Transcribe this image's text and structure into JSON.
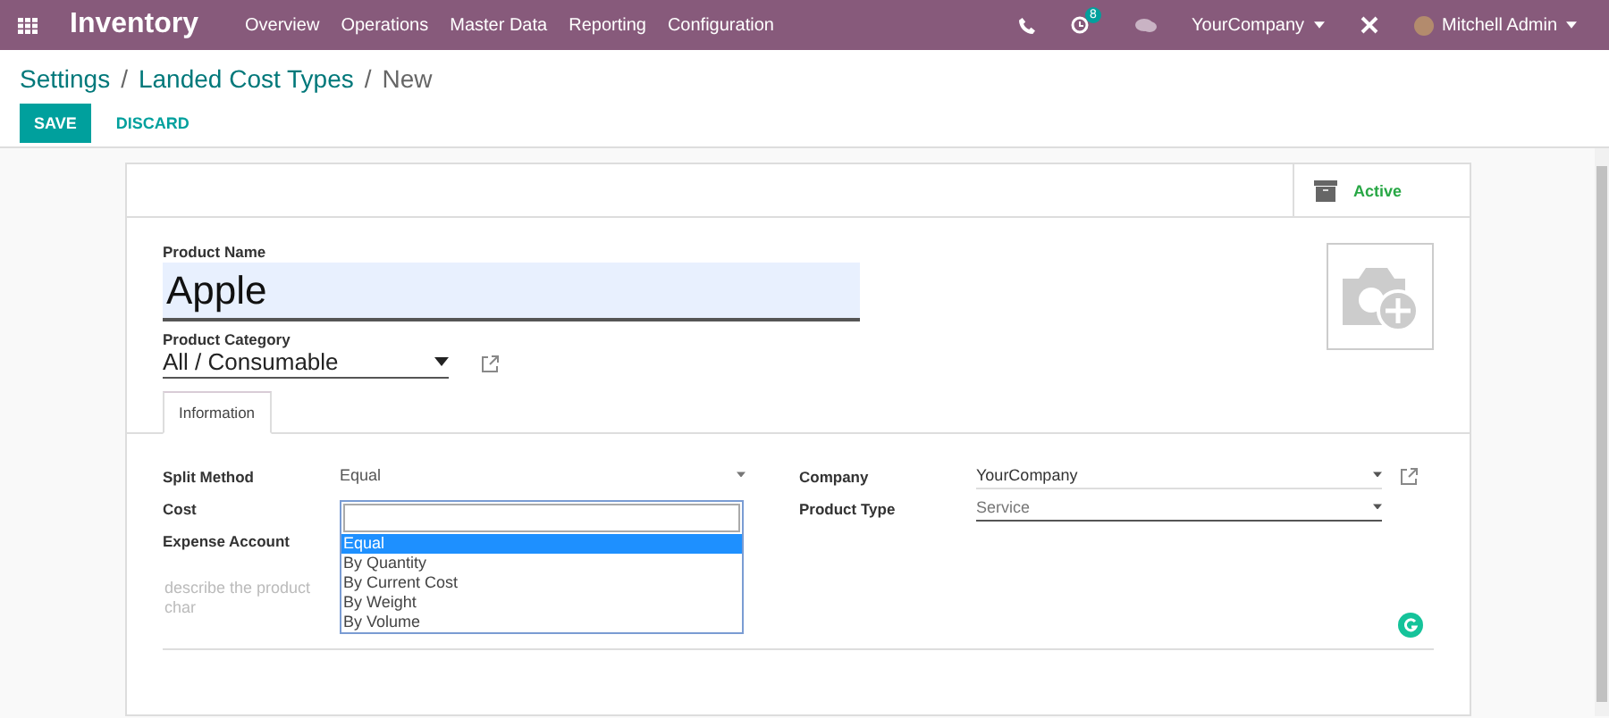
{
  "navbar": {
    "app_name": "Inventory",
    "menu": [
      "Overview",
      "Operations",
      "Master Data",
      "Reporting",
      "Configuration"
    ],
    "activity_count": "8",
    "company": "YourCompany",
    "user": "Mitchell Admin"
  },
  "breadcrumbs": [
    {
      "label": "Settings",
      "link": true
    },
    {
      "separator": "/",
      "label": "Landed Cost Types",
      "link": true
    },
    {
      "separator": "/",
      "label": "New",
      "link": false
    }
  ],
  "buttons": [
    {
      "label": "SAVE",
      "kind": "primary"
    },
    {
      "label": "DISCARD",
      "kind": "link"
    }
  ],
  "status": {
    "label": "Active"
  },
  "product_name": {
    "label": "Product Name",
    "value": "Apple"
  },
  "product_category": {
    "label": "Product Category",
    "value": "All / Consumable"
  },
  "tabs": [
    {
      "label": "Information",
      "selected": true
    }
  ],
  "left_fields": [
    {
      "label": "Split Method",
      "value": "Equal"
    },
    {
      "label": "Cost"
    },
    {
      "label": "Expense Account"
    }
  ],
  "right_fields": [
    {
      "label": "Company",
      "value": "YourCompany",
      "external_link": true,
      "muted": false
    },
    {
      "label": "Product Type",
      "value": "Service",
      "external_link": false,
      "muted": true
    }
  ],
  "dropdown": {
    "options": [
      {
        "label": "Equal",
        "selected": true
      },
      {
        "label": "By Quantity",
        "selected": false
      },
      {
        "label": "By Current Cost",
        "selected": false
      },
      {
        "label": "By Weight",
        "selected": false
      },
      {
        "label": "By Volume",
        "selected": false
      }
    ]
  },
  "description": {
    "placeholder": "describe the product char"
  }
}
